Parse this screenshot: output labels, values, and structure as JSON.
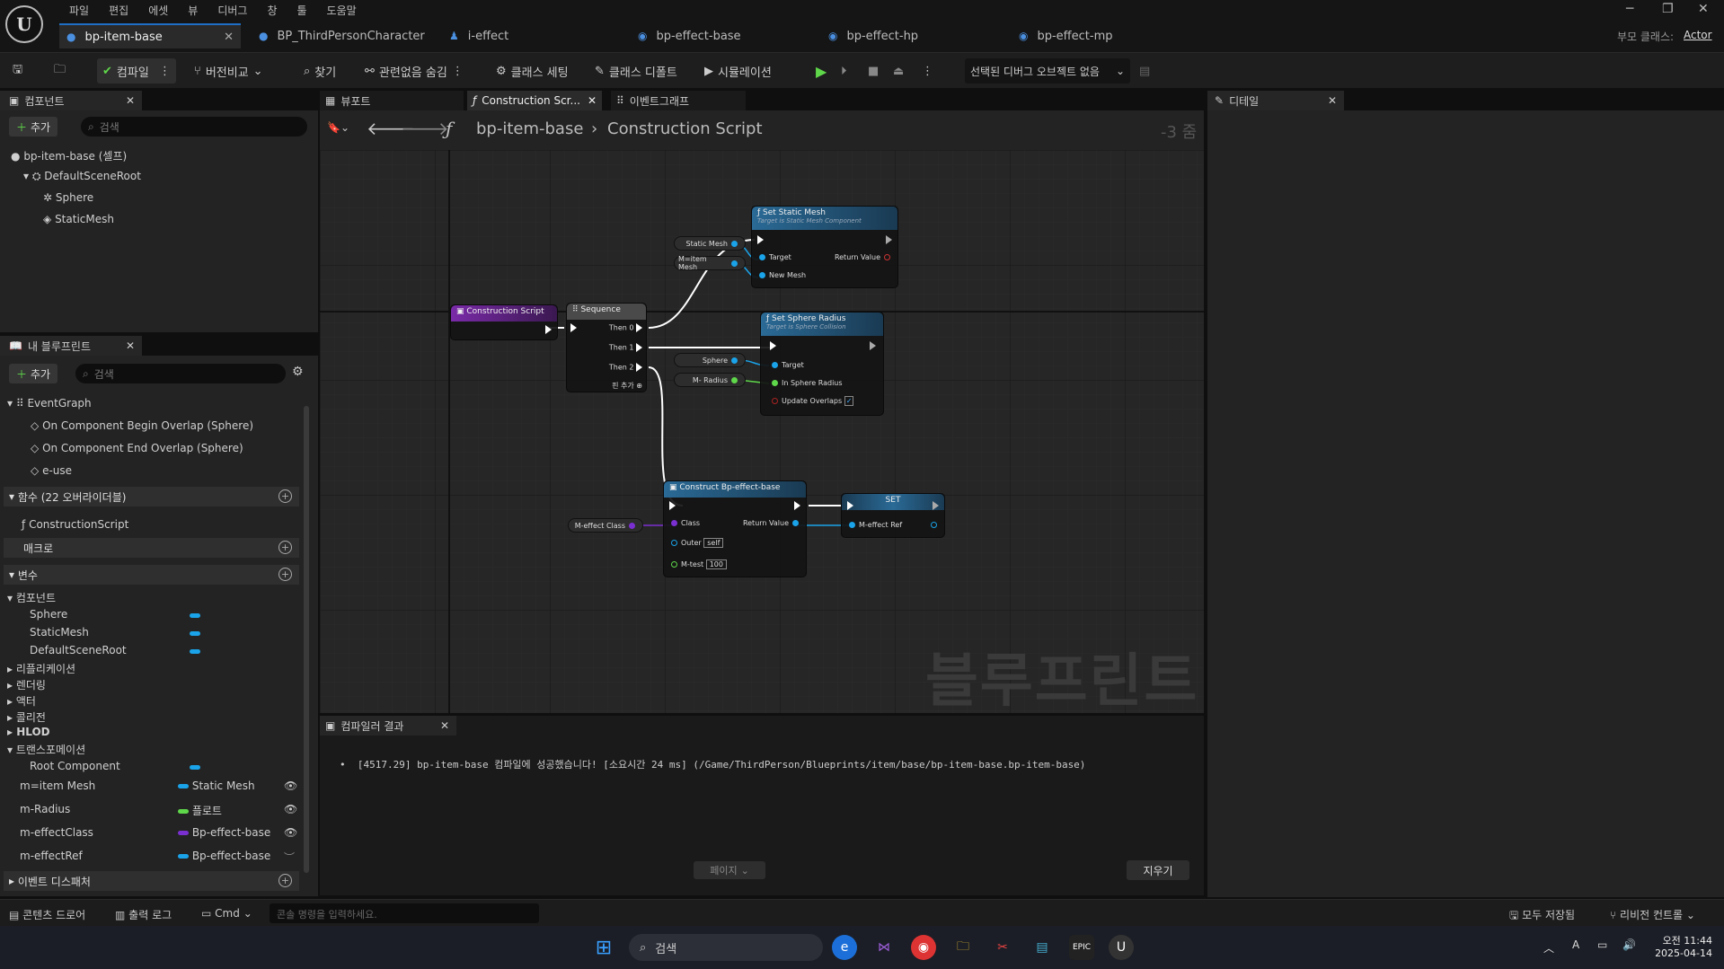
{
  "menu": [
    "파일",
    "편집",
    "에셋",
    "뷰",
    "디버그",
    "창",
    "툴",
    "도움말"
  ],
  "tabs": [
    {
      "label": "bp-item-base",
      "icon": "person-icon"
    },
    {
      "label": "BP_ThirdPersonCharacter",
      "icon": "person-icon"
    },
    {
      "label": "i-effect",
      "icon": "interface-icon"
    },
    {
      "label": "bp-effect-base",
      "icon": "blueprint-icon"
    },
    {
      "label": "bp-effect-hp",
      "icon": "blueprint-icon"
    },
    {
      "label": "bp-effect-mp",
      "icon": "blueprint-icon"
    }
  ],
  "parent_class_label": "부모 클래스:",
  "parent_class": "Actor",
  "toolbar": {
    "compile": "컴파일",
    "diff": "버전비교",
    "find": "찾기",
    "hide_unrelated": "관련없음 숨김",
    "class_settings": "클래스 세팅",
    "class_defaults": "클래스 디폴트",
    "simulation": "시뮬레이션",
    "debug_object": "선택된 디버그 오브젝트 없음"
  },
  "components_panel": {
    "title": "컴포넌트",
    "add": "추가",
    "search": "검색",
    "self": "bp-item-base (셀프)",
    "items": [
      "DefaultSceneRoot",
      "Sphere",
      "StaticMesh"
    ]
  },
  "my_blueprint": {
    "title": "내 블루프린트",
    "add": "추가",
    "search": "검색",
    "eventgraph": "EventGraph",
    "events": [
      "On Component Begin Overlap (Sphere)",
      "On Component End Overlap (Sphere)",
      "e-use"
    ],
    "functions_hdr": "함수 (22 오버라이더블)",
    "function": "ConstructionScript",
    "macros_hdr": "매크로",
    "variables_hdr": "변수",
    "components_cat": "컴포넌트",
    "comp_vars": [
      "Sphere",
      "StaticMesh",
      "DefaultSceneRoot"
    ],
    "categories": [
      "리플리케이션",
      "렌더링",
      "액터",
      "콜리전",
      "HLOD",
      "트랜스포메이션"
    ],
    "root_component": "Root Component",
    "vars": [
      {
        "name": "m=item Mesh",
        "type": "Static Mesh",
        "color": "#1aa3e8"
      },
      {
        "name": "m-Radius",
        "type": "플로트",
        "color": "#5fd74a"
      },
      {
        "name": "m-effectClass",
        "type": "Bp-effect-base",
        "color": "#7a2fd0"
      },
      {
        "name": "m-effectRef",
        "type": "Bp-effect-base",
        "color": "#1aa3e8"
      }
    ],
    "dispatchers_hdr": "이벤트 디스패처"
  },
  "graph_tabs": [
    "뷰포트",
    "Construction Scr...",
    "이벤트그래프"
  ],
  "breadcrumb": {
    "bp": "bp-item-base",
    "graph": "Construction Script",
    "zoom": "-3 줌"
  },
  "watermark": "블루프린트",
  "details": {
    "title": "디테일"
  },
  "nodes": {
    "construction": "Construction Script",
    "sequence": "Sequence",
    "then0": "Then 0",
    "then1": "Then 1",
    "then2": "Then 2",
    "add_pin": "핀 추가",
    "set_static_mesh": "Set Static Mesh",
    "ssm_sub": "Target is Static Mesh Component",
    "target": "Target",
    "return_value": "Return Value",
    "new_mesh": "New Mesh",
    "var_static_mesh": "Static Mesh",
    "var_item_mesh": "M=item Mesh",
    "set_sphere_radius": "Set Sphere Radius",
    "ssr_sub": "Target is Sphere Collision",
    "in_sphere_radius": "In Sphere Radius",
    "update_overlaps": "Update Overlaps",
    "var_sphere": "Sphere",
    "var_radius": "M- Radius",
    "construct": "Construct Bp-effect-base",
    "class": "Class",
    "outer": "Outer",
    "outer_val": "self",
    "mtest": "M-test",
    "mtest_val": "100",
    "var_effect_class": "M-effect Class",
    "set": "SET",
    "effect_ref": "M-effect Ref"
  },
  "compiler": {
    "title": "컴파일러 결과",
    "message": "[4517.29] bp-item-base 컴파일에 성공했습니다! [소요시간 24 ms] (/Game/ThirdPerson/Blueprints/item/base/bp-item-base.bp-item-base)",
    "page": "페이지",
    "clear": "지우기"
  },
  "statusbar": {
    "content_drawer": "콘텐츠 드로어",
    "output_log": "출력 로그",
    "cmd": "Cmd",
    "console_placeholder": "콘솔 명령을 입력하세요.",
    "save_all": "모두 저장됨",
    "revision": "리비전 컨트롤"
  },
  "taskbar": {
    "search": "검색",
    "time": "오전 11:44",
    "date": "2025-04-14"
  }
}
